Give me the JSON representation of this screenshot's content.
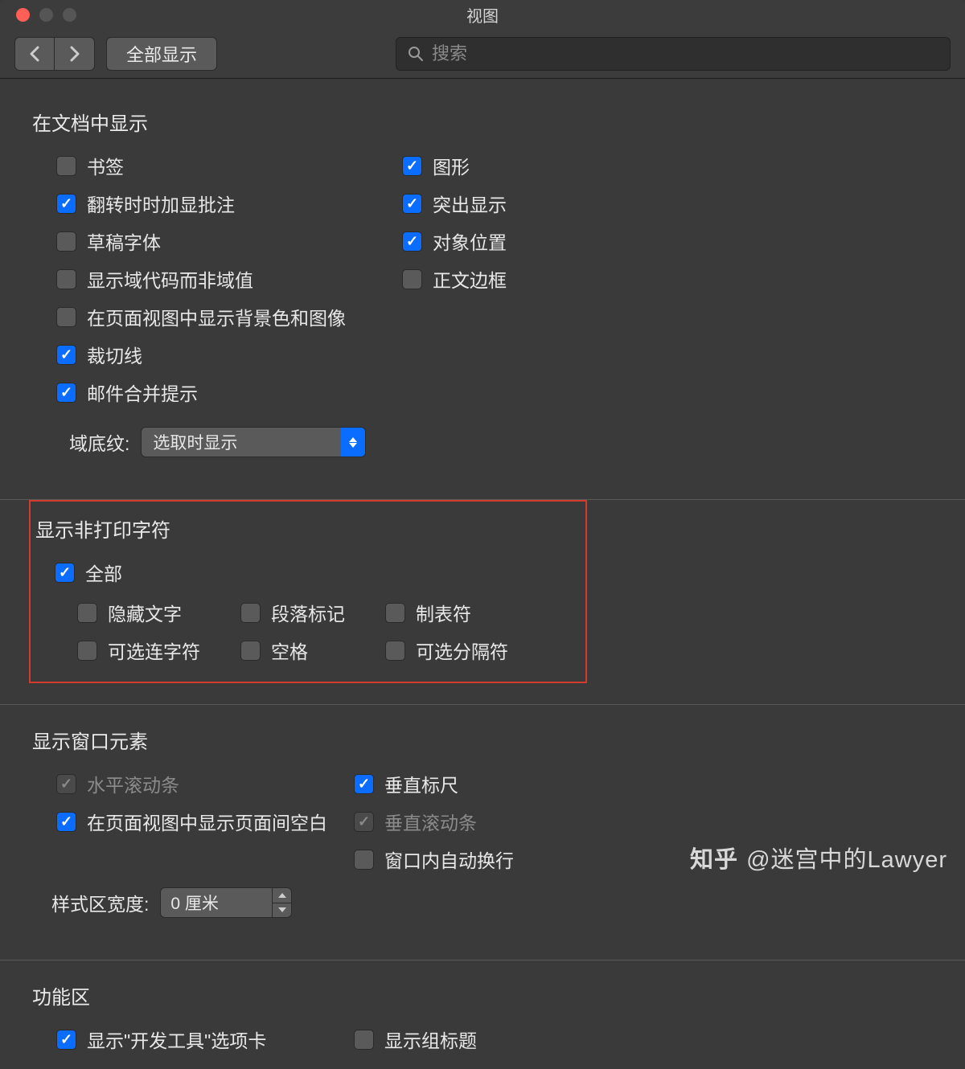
{
  "window": {
    "title": "视图"
  },
  "toolbar": {
    "show_all": "全部显示",
    "search_placeholder": "搜索"
  },
  "sections": {
    "in_document": {
      "title": "在文档中显示",
      "left": [
        {
          "label": "书签",
          "checked": false
        },
        {
          "label": "翻转时时加显批注",
          "checked": true
        },
        {
          "label": "草稿字体",
          "checked": false
        },
        {
          "label": "显示域代码而非域值",
          "checked": false
        },
        {
          "label": "在页面视图中显示背景色和图像",
          "checked": false
        },
        {
          "label": "裁切线",
          "checked": true
        },
        {
          "label": "邮件合并提示",
          "checked": true
        }
      ],
      "right": [
        {
          "label": "图形",
          "checked": true
        },
        {
          "label": "突出显示",
          "checked": true
        },
        {
          "label": "对象位置",
          "checked": true
        },
        {
          "label": "正文边框",
          "checked": false
        }
      ],
      "field_shading_label": "域底纹:",
      "field_shading_value": "选取时显示"
    },
    "nonprinting": {
      "title": "显示非打印字符",
      "all": {
        "label": "全部",
        "checked": true
      },
      "cols": [
        [
          {
            "label": "隐藏文字",
            "checked": false
          },
          {
            "label": "可选连字符",
            "checked": false
          }
        ],
        [
          {
            "label": "段落标记",
            "checked": false
          },
          {
            "label": "空格",
            "checked": false
          }
        ],
        [
          {
            "label": "制表符",
            "checked": false
          },
          {
            "label": "可选分隔符",
            "checked": false
          }
        ]
      ]
    },
    "window_elements": {
      "title": "显示窗口元素",
      "left": [
        {
          "label": "水平滚动条",
          "checked": true,
          "disabled": true
        },
        {
          "label": "在页面视图中显示页面间空白",
          "checked": true
        }
      ],
      "right": [
        {
          "label": "垂直标尺",
          "checked": true
        },
        {
          "label": "垂直滚动条",
          "checked": true,
          "disabled": true
        },
        {
          "label": "窗口内自动换行",
          "checked": false
        }
      ],
      "style_width_label": "样式区宽度:",
      "style_width_value": "0 厘米"
    },
    "ribbon": {
      "title": "功能区",
      "left": [
        {
          "label": "显示\"开发工具\"选项卡",
          "checked": true
        }
      ],
      "right": [
        {
          "label": "显示组标题",
          "checked": false
        }
      ]
    }
  },
  "watermark": {
    "logo": "知乎",
    "handle": "@迷宫中的Lawyer"
  }
}
